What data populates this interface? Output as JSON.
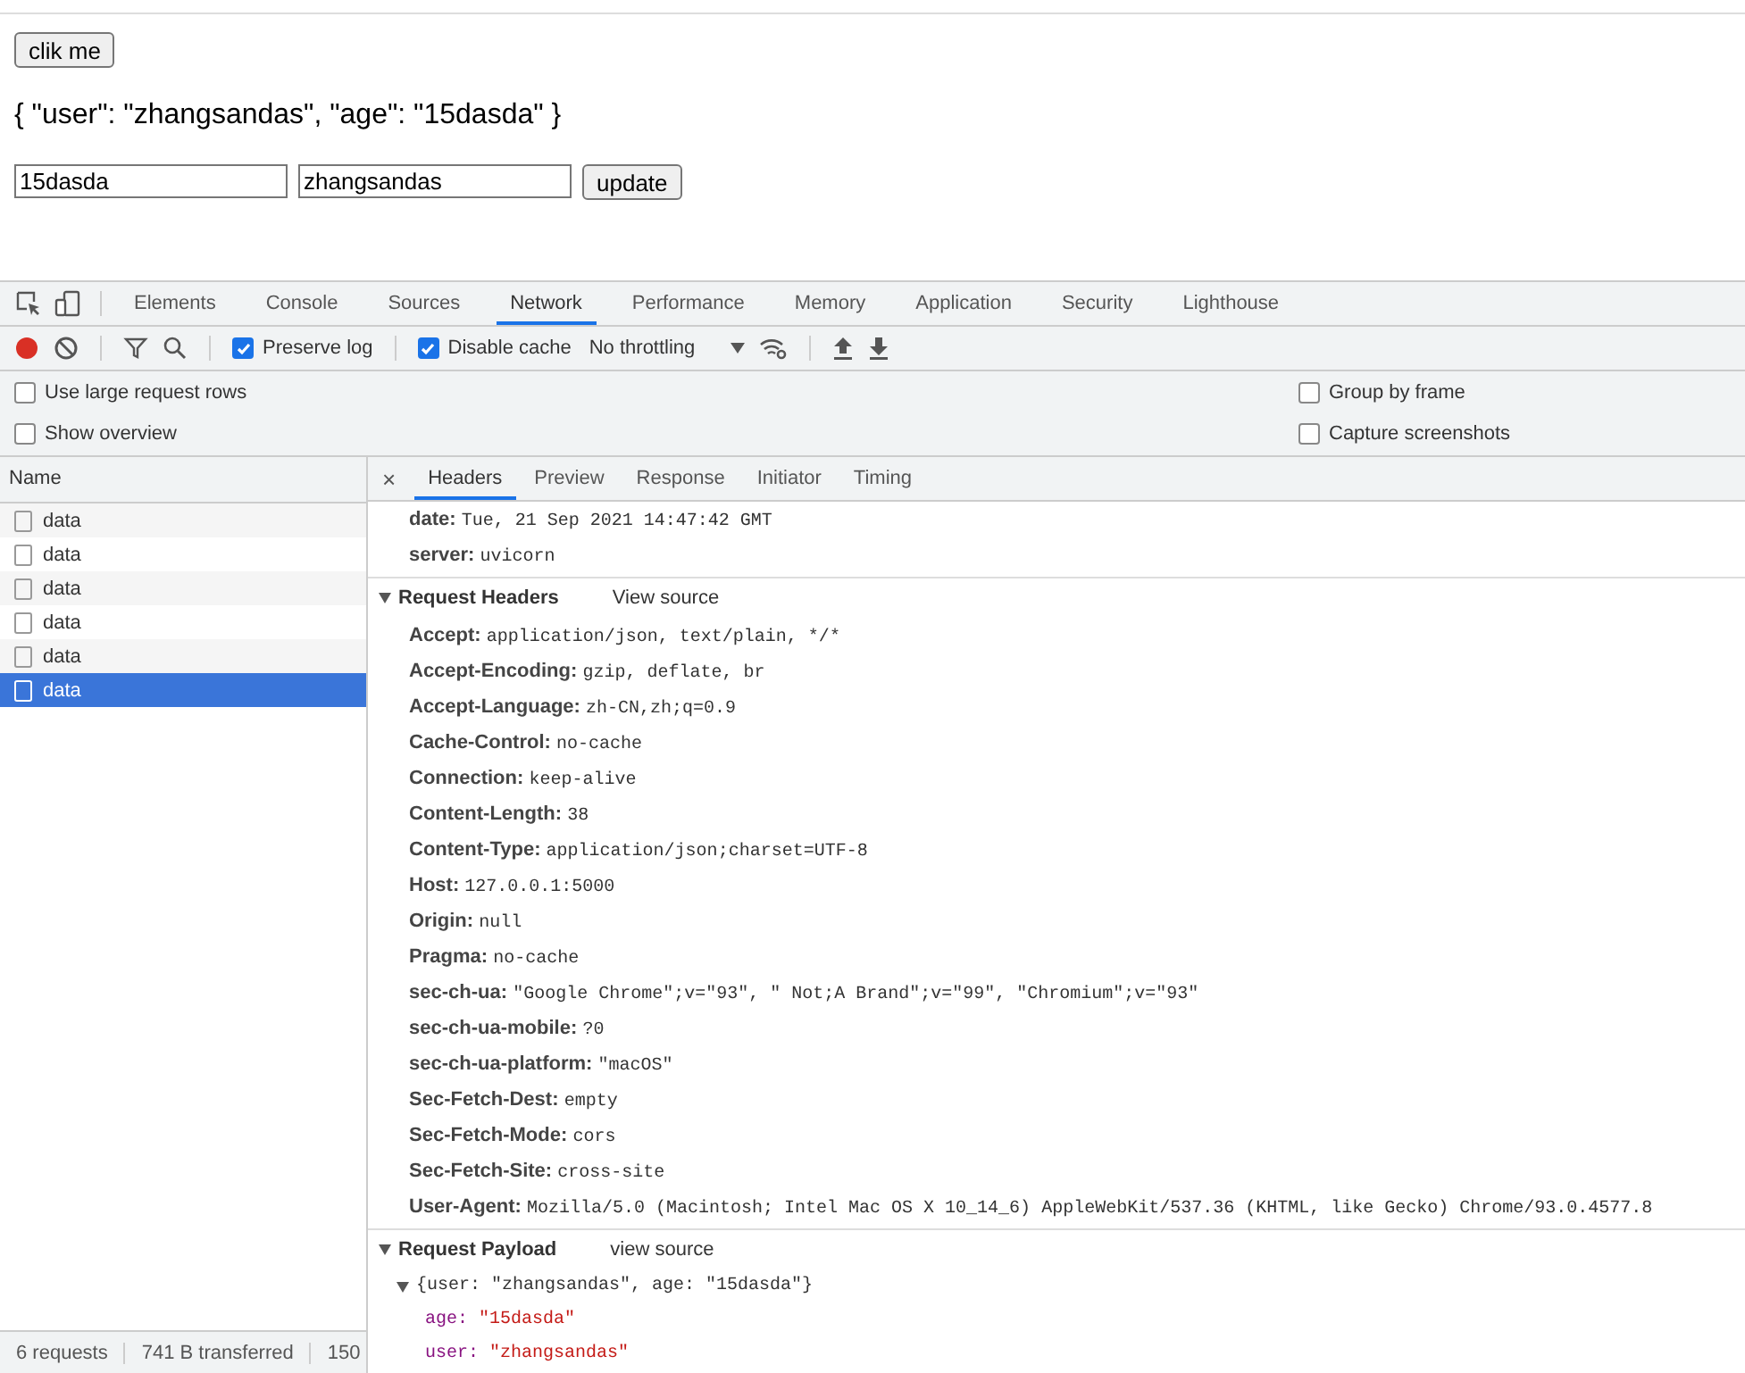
{
  "page": {
    "button": "clik me",
    "output": "{ \"user\": \"zhangsandas\", \"age\": \"15dasda\" }",
    "inputs": [
      {
        "value": "15dasda"
      },
      {
        "value": "zhangsandas"
      }
    ],
    "update_button": "update"
  },
  "devtools": {
    "tabs": [
      {
        "label": "Elements",
        "selected": false
      },
      {
        "label": "Console",
        "selected": false
      },
      {
        "label": "Sources",
        "selected": false
      },
      {
        "label": "Network",
        "selected": true
      },
      {
        "label": "Performance",
        "selected": false
      },
      {
        "label": "Memory",
        "selected": false
      },
      {
        "label": "Application",
        "selected": false
      },
      {
        "label": "Security",
        "selected": false
      },
      {
        "label": "Lighthouse",
        "selected": false
      }
    ],
    "toolbar": {
      "recording": true,
      "preserve_log": {
        "label": "Preserve log",
        "checked": true
      },
      "disable_cache": {
        "label": "Disable cache",
        "checked": true
      },
      "throttling": "No throttling"
    },
    "options_left": [
      {
        "label": "Use large request rows",
        "checked": false
      },
      {
        "label": "Show overview",
        "checked": false
      }
    ],
    "options_right": [
      {
        "label": "Group by frame",
        "checked": false
      },
      {
        "label": "Capture screenshots",
        "checked": false
      }
    ],
    "requests": {
      "column": "Name",
      "rows": [
        {
          "name": "data",
          "selected": false
        },
        {
          "name": "data",
          "selected": false
        },
        {
          "name": "data",
          "selected": false
        },
        {
          "name": "data",
          "selected": false
        },
        {
          "name": "data",
          "selected": false
        },
        {
          "name": "data",
          "selected": true
        }
      ]
    },
    "status_bar": [
      "6 requests",
      "741 B transferred",
      "150"
    ],
    "detail": {
      "close": "×",
      "tabs": [
        {
          "label": "Headers",
          "selected": true
        },
        {
          "label": "Preview",
          "selected": false
        },
        {
          "label": "Response",
          "selected": false
        },
        {
          "label": "Initiator",
          "selected": false
        },
        {
          "label": "Timing",
          "selected": false
        }
      ],
      "response_headers": [
        {
          "name": "date:",
          "value": "Tue, 21 Sep 2021 14:47:42 GMT"
        },
        {
          "name": "server:",
          "value": "uvicorn"
        }
      ],
      "request_headers": {
        "title": "Request Headers",
        "expanded": true,
        "link": "View source",
        "rows": [
          {
            "name": "Accept:",
            "value": "application/json, text/plain, */*"
          },
          {
            "name": "Accept-Encoding:",
            "value": "gzip, deflate, br"
          },
          {
            "name": "Accept-Language:",
            "value": "zh-CN,zh;q=0.9"
          },
          {
            "name": "Cache-Control:",
            "value": "no-cache"
          },
          {
            "name": "Connection:",
            "value": "keep-alive"
          },
          {
            "name": "Content-Length:",
            "value": "38"
          },
          {
            "name": "Content-Type:",
            "value": "application/json;charset=UTF-8"
          },
          {
            "name": "Host:",
            "value": "127.0.0.1:5000"
          },
          {
            "name": "Origin:",
            "value": "null"
          },
          {
            "name": "Pragma:",
            "value": "no-cache"
          },
          {
            "name": "sec-ch-ua:",
            "value": "\"Google Chrome\";v=\"93\", \" Not;A Brand\";v=\"99\", \"Chromium\";v=\"93\""
          },
          {
            "name": "sec-ch-ua-mobile:",
            "value": "?0"
          },
          {
            "name": "sec-ch-ua-platform:",
            "value": "\"macOS\""
          },
          {
            "name": "Sec-Fetch-Dest:",
            "value": "empty"
          },
          {
            "name": "Sec-Fetch-Mode:",
            "value": "cors"
          },
          {
            "name": "Sec-Fetch-Site:",
            "value": "cross-site"
          },
          {
            "name": "User-Agent:",
            "value": "Mozilla/5.0 (Macintosh; Intel Mac OS X 10_14_6) AppleWebKit/537.36 (KHTML, like Gecko) Chrome/93.0.4577.8"
          }
        ]
      },
      "payload": {
        "title": "Request Payload",
        "expanded": true,
        "link": "view source",
        "summary": "{user: \"zhangsandas\", age: \"15dasda\"}",
        "summary_expanded": true,
        "rows": [
          {
            "key": "age:",
            "value": "\"15dasda\""
          },
          {
            "key": "user:",
            "value": "\"zhangsandas\""
          }
        ]
      }
    }
  }
}
